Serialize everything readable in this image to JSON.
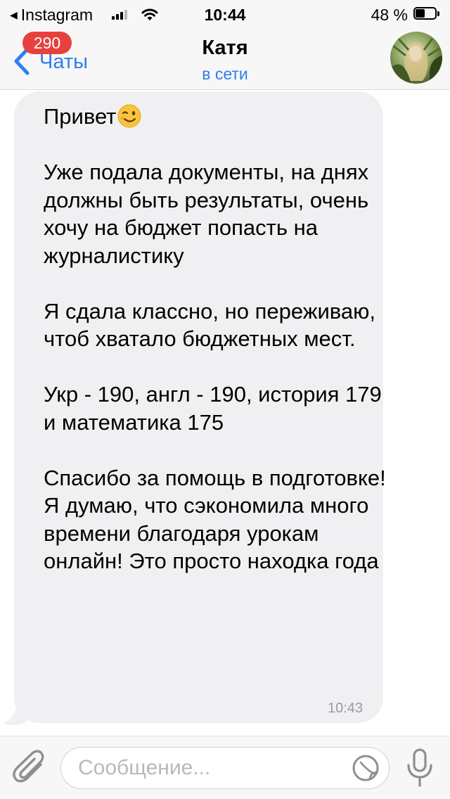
{
  "status_bar": {
    "back_app": "Instagram",
    "time": "10:44",
    "battery_percent": "48 %",
    "battery_level": 0.48,
    "signal_bars_filled": 3,
    "signal_bars_total": 4
  },
  "nav": {
    "back_label": "Чаты",
    "unread_badge": "290",
    "chat_title": "Катя",
    "chat_status": "в сети"
  },
  "message": {
    "paragraphs": [
      "Привет",
      "Уже подала документы, на днях должны быть результаты, очень хочу на бюджет попасть на журналистику",
      "Я сдала классно, но переживаю, чтоб хватало бюджетных мест.",
      "Укр - 190, англ - 190, история 179 и математика 175",
      "Спасибо за помощь в подготовке! Я думаю, что сэкономила много времени благодаря урокам онлайн! Это просто находка года"
    ],
    "time": "10:43"
  },
  "input": {
    "placeholder": "Сообщение..."
  },
  "icons": {
    "back": "chevron-left-icon",
    "attach": "paperclip-icon",
    "sticker": "sticker-icon",
    "mic": "microphone-icon",
    "emoji": "winking-face-emoji"
  },
  "colors": {
    "accent": "#2f7fea",
    "badge": "#e8413d",
    "bubble": "#f0f0f3",
    "bar_background": "#f7f7f7",
    "muted_text": "#9a9aa0"
  }
}
